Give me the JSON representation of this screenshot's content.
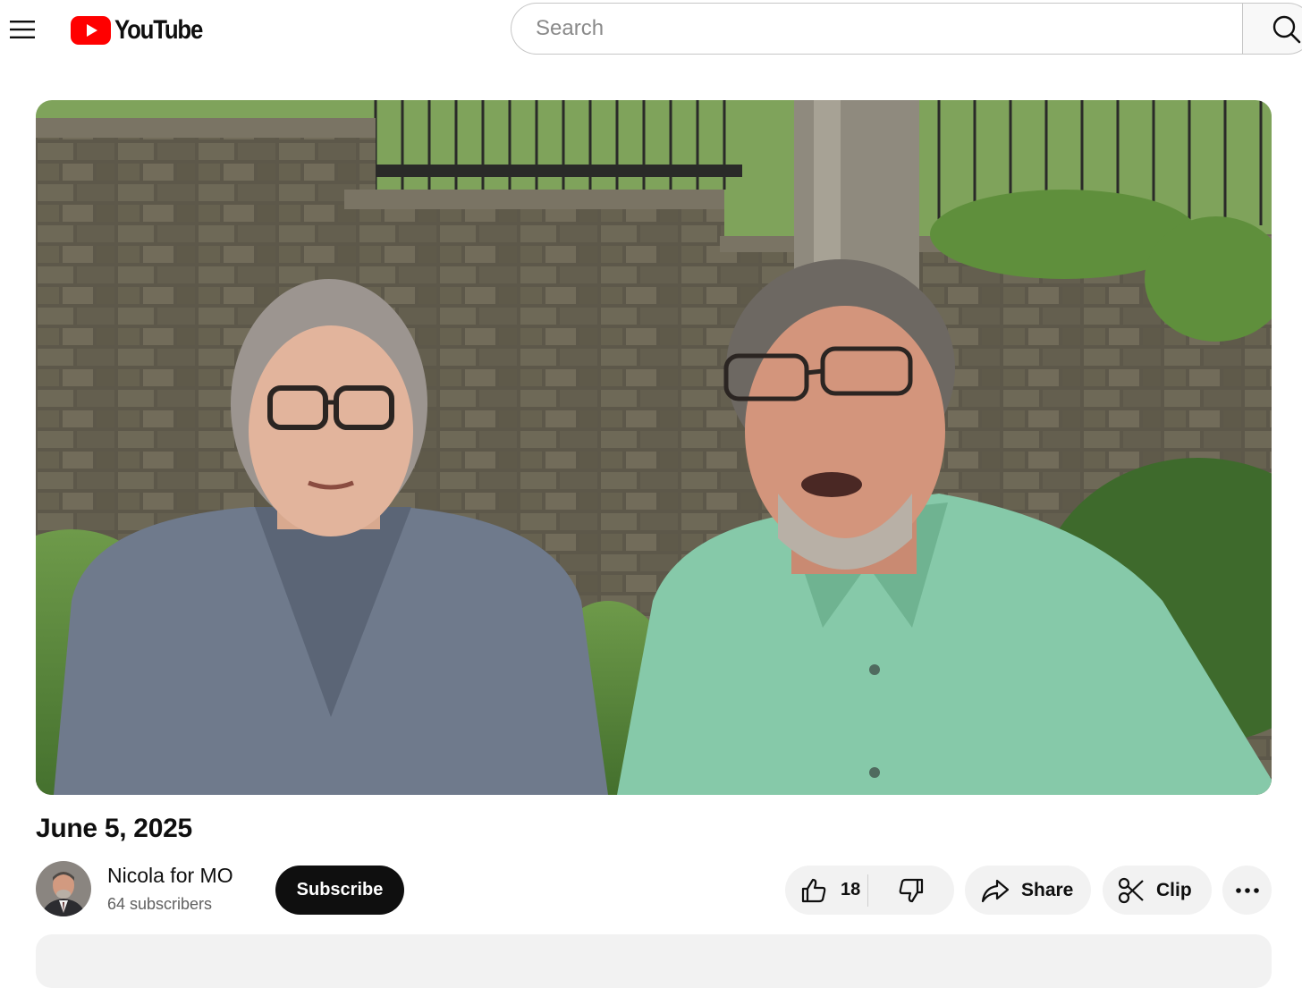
{
  "header": {
    "logo_text": "YouTube",
    "search_placeholder": "Search",
    "search_value": ""
  },
  "video": {
    "title": "June 5, 2025"
  },
  "channel": {
    "name": "Nicola for MO",
    "subscribers": "64 subscribers",
    "subscribe_label": "Subscribe"
  },
  "actions": {
    "like_count": "18",
    "share_label": "Share",
    "clip_label": "Clip"
  },
  "icons": {
    "menu": "hamburger-menu-icon",
    "logo": "youtube-play-icon",
    "search": "search-icon",
    "like": "thumbs-up-icon",
    "dislike": "thumbs-down-icon",
    "share": "share-arrow-icon",
    "clip": "scissors-icon",
    "more": "more-horizontal-icon"
  },
  "colors": {
    "brand_red": "#ff0000",
    "subscribe_bg": "#0f0f0f",
    "pill_bg": "#f2f2f2",
    "secondary_text": "#606060"
  }
}
